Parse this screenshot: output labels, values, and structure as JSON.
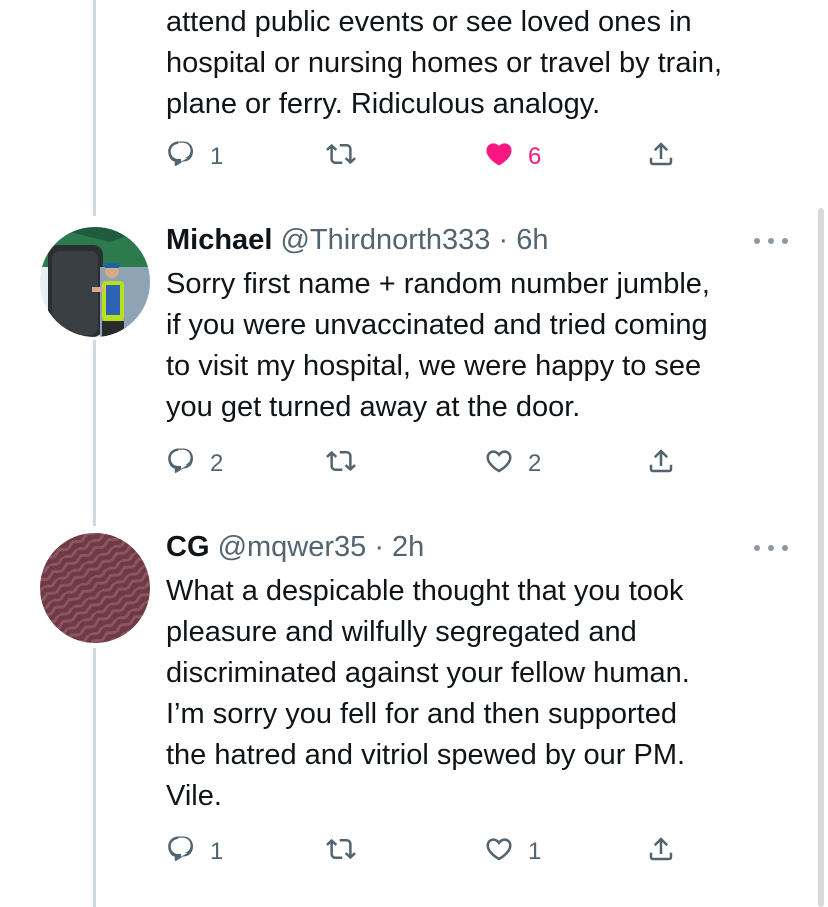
{
  "tweets": [
    {
      "text": "attend public events or see loved ones in\nhospital or nursing homes or travel by train,\nplane or ferry. Ridiculous analogy.",
      "replies": "1",
      "retweets": "",
      "likes": "6",
      "liked": true
    },
    {
      "name": "Michael",
      "handle": "@Thirdnorth333",
      "time": "· 6h",
      "text": "Sorry first name + random number jumble,\nif you were unvaccinated and tried coming\nto visit my hospital, we were happy to see\nyou get turned away at the door.",
      "replies": "2",
      "retweets": "",
      "likes": "2",
      "liked": false
    },
    {
      "name": "CG",
      "handle": "@mqwer35",
      "time": "· 2h",
      "text": "What a despicable thought that you took\npleasure and wilfully segregated and\ndiscriminated against your fellow human.\nI’m sorry you fell for and then supported\nthe hatred and vitriol spewed by our PM.\nVile.",
      "replies": "1",
      "retweets": "",
      "likes": "1",
      "liked": false
    }
  ],
  "icons": {
    "reply": "reply-icon",
    "retweet": "retweet-icon",
    "like": "heart-icon",
    "share": "share-icon",
    "more": "more-icon"
  },
  "colors": {
    "text": "#0f1419",
    "secondary": "#536471",
    "like": "#f91880",
    "thread_line": "#cfd9de"
  }
}
